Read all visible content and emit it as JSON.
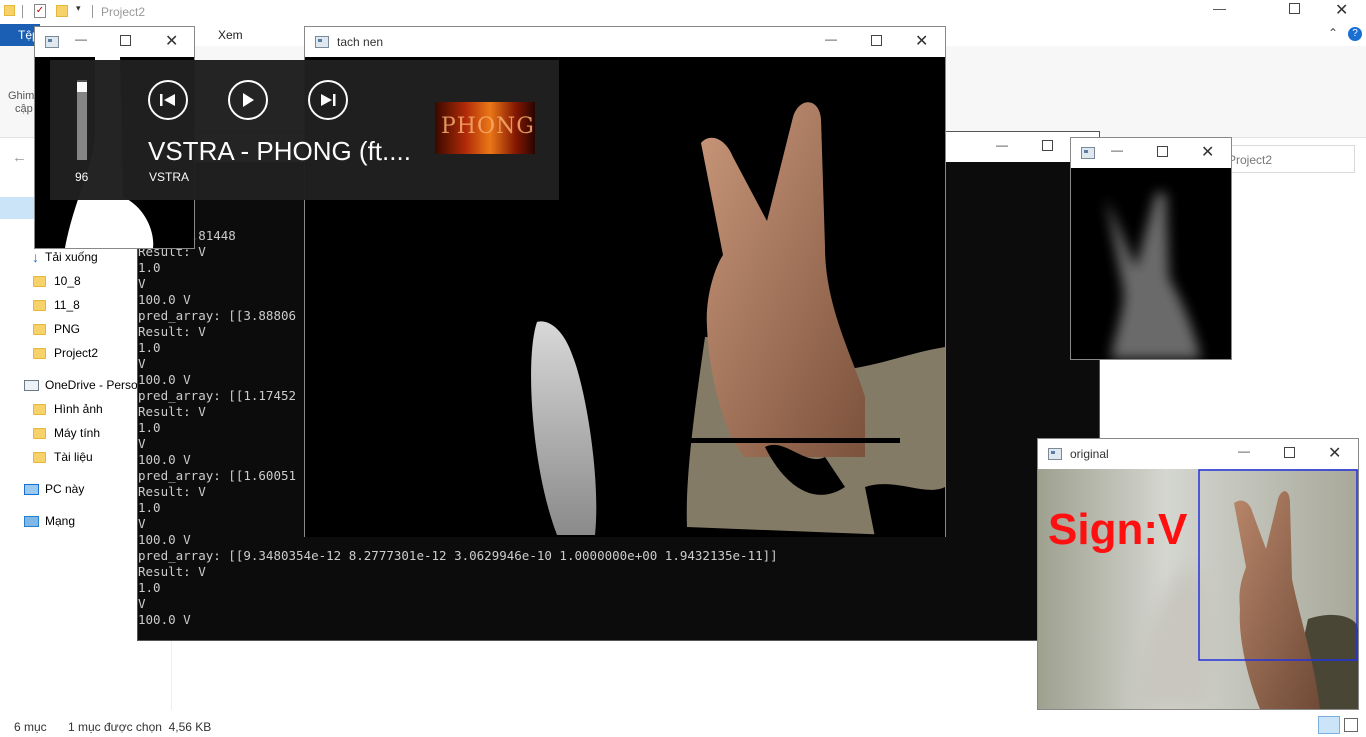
{
  "explorer": {
    "title": "Project2",
    "tab_file": "Tệp",
    "tab_view": "Xem",
    "ribbon_pin_line1": "Ghim",
    "ribbon_pin_line2": "cập",
    "search_placeholder": "Project2",
    "sidebar": {
      "downloads": "Tải xuống",
      "f1": "10_8",
      "f2": "11_8",
      "f3": "PNG",
      "f4": "Project2",
      "onedrive": "OneDrive - Person",
      "od1": "Hình ảnh",
      "od2": "Máy tính",
      "od3": "Tài liệu",
      "pc": "PC này",
      "network": "Mạng"
    },
    "status_count": "6 mục",
    "status_selected": "1 mục được chọn  4,56 KB"
  },
  "console": {
    "lines": [
      "ay: [[7.81448",
      "Result: V",
      "1.0",
      "V",
      "100.0 V",
      "pred_array: [[3.88806",
      "Result: V",
      "1.0",
      "V",
      "100.0 V",
      "pred_array: [[1.17452",
      "Result: V",
      "1.0",
      "V",
      "100.0 V",
      "pred_array: [[1.60051",
      "Result: V",
      "1.0",
      "V",
      "100.0 V",
      "pred_array: [[9.3480354e-12 8.2777301e-12 3.0629946e-10 1.0000000e+00 1.9432135e-11]]",
      "Result: V",
      "1.0",
      "V",
      "100.0 V"
    ]
  },
  "tachnen": {
    "title": "tach nen"
  },
  "media": {
    "volume": "96",
    "volume_level": 0.96,
    "song_title": "VSTRA - PHONG (ft....",
    "artist": "VSTRA",
    "album_text": "PHONG"
  },
  "original": {
    "title": "original",
    "sign_text": "Sign:V"
  },
  "colors": {
    "sign": "#ff1010",
    "roi": "#2233dd"
  }
}
